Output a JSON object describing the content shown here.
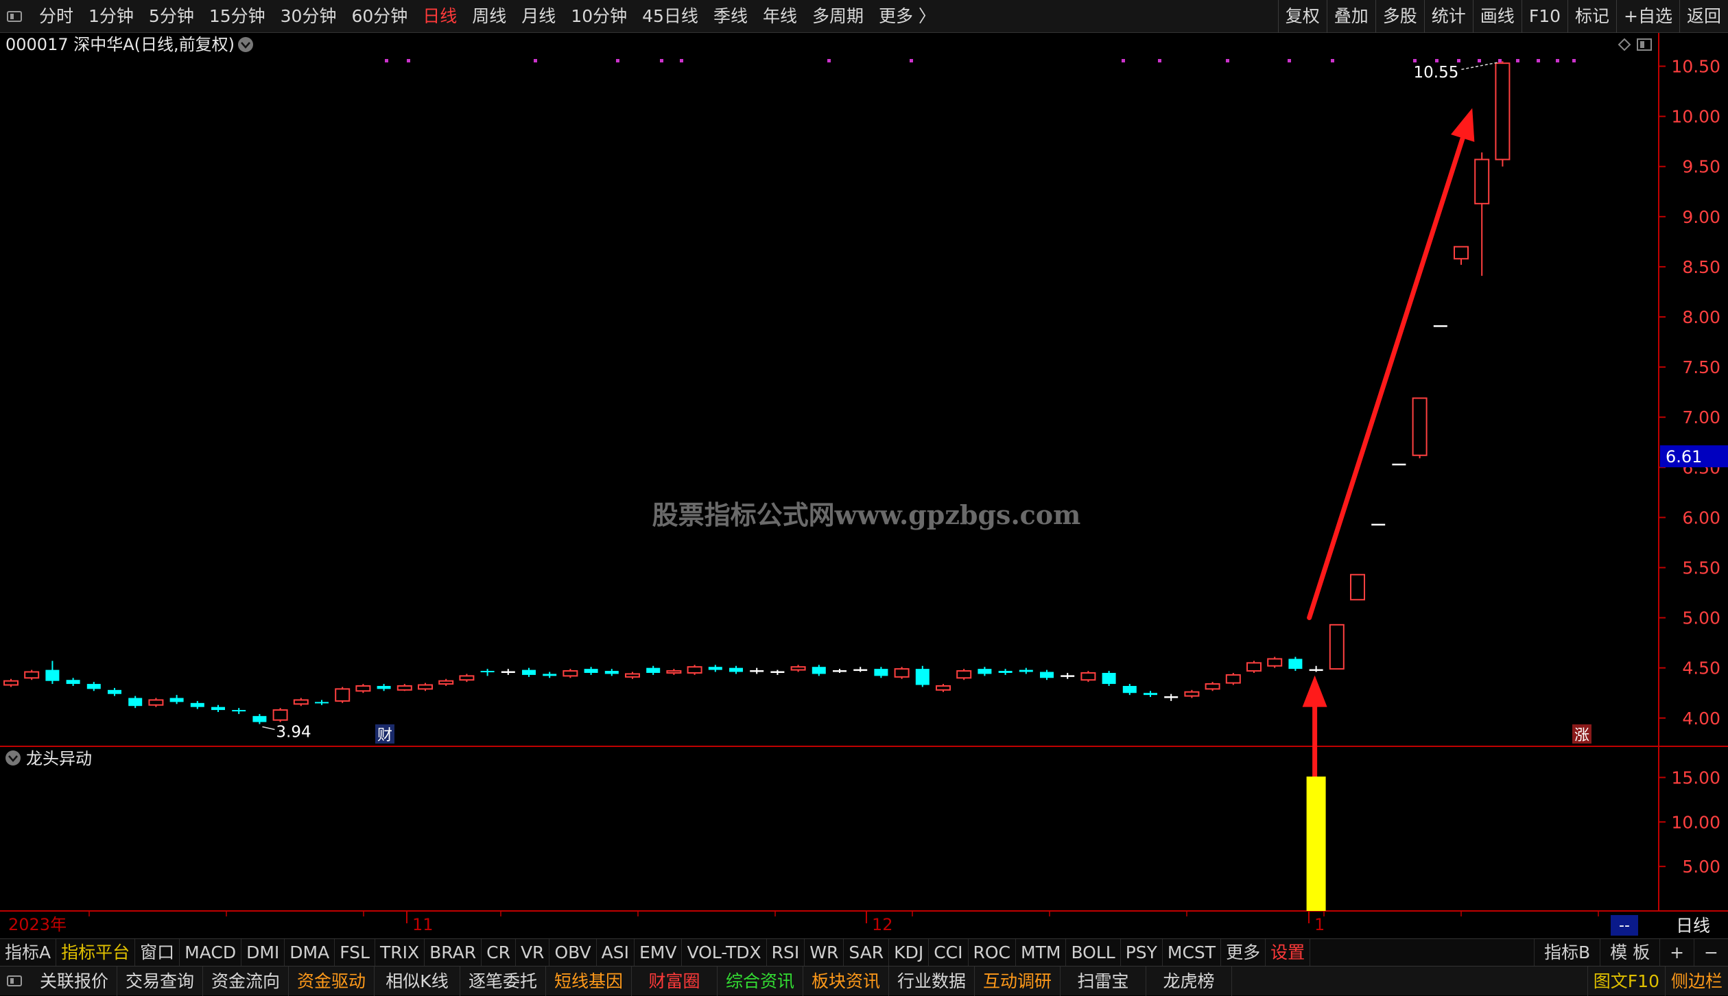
{
  "topbar": {
    "periods": [
      "分时",
      "1分钟",
      "5分钟",
      "15分钟",
      "30分钟",
      "60分钟",
      "日线",
      "周线",
      "月线",
      "10分钟",
      "45日线",
      "季线",
      "年线",
      "多周期",
      "更多 〉"
    ],
    "active_period": "日线",
    "right_buttons": [
      "复权",
      "叠加",
      "多股",
      "统计",
      "画线",
      "F10",
      "标记",
      "+自选",
      "返回"
    ]
  },
  "stock": {
    "title": "000017 深中华A(日线,前复权)"
  },
  "watermark": "股票指标公式网www.gpzbgs.com",
  "colors": {
    "up": "#ff4040",
    "down": "#00ffff",
    "axis": "#c00000",
    "vol": "#ffff00",
    "marker": "#cc33cc",
    "price_tag_bg": "#0000c0"
  },
  "chart_data": {
    "type": "candlestick",
    "ylim": [
      3.8,
      10.75
    ],
    "y_ticks": [
      "10.50",
      "10.00",
      "9.50",
      "9.00",
      "8.50",
      "8.00",
      "7.50",
      "7.00",
      "6.50",
      "6.00",
      "5.50",
      "5.00",
      "4.50",
      "4.00"
    ],
    "candles": [
      {
        "o": 4.33,
        "c": 4.37,
        "h": 4.39,
        "l": 4.31
      },
      {
        "o": 4.4,
        "c": 4.46,
        "h": 4.48,
        "l": 4.38
      },
      {
        "o": 4.48,
        "c": 4.37,
        "h": 4.57,
        "l": 4.34
      },
      {
        "o": 4.38,
        "c": 4.34,
        "h": 4.4,
        "l": 4.32
      },
      {
        "o": 4.34,
        "c": 4.29,
        "h": 4.36,
        "l": 4.27
      },
      {
        "o": 4.28,
        "c": 4.24,
        "h": 4.3,
        "l": 4.22
      },
      {
        "o": 4.2,
        "c": 4.12,
        "h": 4.22,
        "l": 4.1
      },
      {
        "o": 4.13,
        "c": 4.18,
        "h": 4.2,
        "l": 4.11
      },
      {
        "o": 4.2,
        "c": 4.16,
        "h": 4.23,
        "l": 4.14
      },
      {
        "o": 4.15,
        "c": 4.11,
        "h": 4.17,
        "l": 4.09
      },
      {
        "o": 4.11,
        "c": 4.08,
        "h": 4.13,
        "l": 4.06
      },
      {
        "o": 4.08,
        "c": 4.07,
        "h": 4.1,
        "l": 4.04
      },
      {
        "o": 4.02,
        "c": 3.96,
        "h": 4.04,
        "l": 3.94
      },
      {
        "o": 3.98,
        "c": 4.08,
        "h": 4.1,
        "l": 3.96
      },
      {
        "o": 4.14,
        "c": 4.18,
        "h": 4.2,
        "l": 4.12
      },
      {
        "o": 4.16,
        "c": 4.15,
        "h": 4.18,
        "l": 4.13
      },
      {
        "o": 4.17,
        "c": 4.29,
        "h": 4.31,
        "l": 4.15
      },
      {
        "o": 4.27,
        "c": 4.32,
        "h": 4.34,
        "l": 4.25
      },
      {
        "o": 4.32,
        "c": 4.29,
        "h": 4.34,
        "l": 4.27
      },
      {
        "o": 4.28,
        "c": 4.32,
        "h": 4.34,
        "l": 4.27
      },
      {
        "o": 4.29,
        "c": 4.33,
        "h": 4.35,
        "l": 4.27
      },
      {
        "o": 4.34,
        "c": 4.37,
        "h": 4.39,
        "l": 4.32
      },
      {
        "o": 4.38,
        "c": 4.42,
        "h": 4.44,
        "l": 4.36
      },
      {
        "o": 4.47,
        "c": 4.46,
        "h": 4.49,
        "l": 4.42
      },
      {
        "o": 4.46,
        "c": 4.46,
        "h": 4.49,
        "l": 4.43
      },
      {
        "o": 4.48,
        "c": 4.43,
        "h": 4.5,
        "l": 4.41
      },
      {
        "o": 4.44,
        "c": 4.42,
        "h": 4.46,
        "l": 4.4
      },
      {
        "o": 4.42,
        "c": 4.47,
        "h": 4.49,
        "l": 4.4
      },
      {
        "o": 4.49,
        "c": 4.45,
        "h": 4.51,
        "l": 4.43
      },
      {
        "o": 4.47,
        "c": 4.44,
        "h": 4.49,
        "l": 4.42
      },
      {
        "o": 4.41,
        "c": 4.44,
        "h": 4.46,
        "l": 4.39
      },
      {
        "o": 4.5,
        "c": 4.45,
        "h": 4.52,
        "l": 4.43
      },
      {
        "o": 4.45,
        "c": 4.47,
        "h": 4.49,
        "l": 4.43
      },
      {
        "o": 4.45,
        "c": 4.51,
        "h": 4.53,
        "l": 4.43
      },
      {
        "o": 4.51,
        "c": 4.48,
        "h": 4.53,
        "l": 4.46
      },
      {
        "o": 4.5,
        "c": 4.46,
        "h": 4.52,
        "l": 4.44
      },
      {
        "o": 4.47,
        "c": 4.47,
        "h": 4.5,
        "l": 4.44
      },
      {
        "o": 4.46,
        "c": 4.46,
        "h": 4.48,
        "l": 4.43
      },
      {
        "o": 4.48,
        "c": 4.51,
        "h": 4.53,
        "l": 4.46
      },
      {
        "o": 4.51,
        "c": 4.44,
        "h": 4.53,
        "l": 4.42
      },
      {
        "o": 4.47,
        "c": 4.47,
        "h": 4.49,
        "l": 4.45
      },
      {
        "o": 4.48,
        "c": 4.48,
        "h": 4.51,
        "l": 4.46
      },
      {
        "o": 4.49,
        "c": 4.42,
        "h": 4.51,
        "l": 4.4
      },
      {
        "o": 4.41,
        "c": 4.49,
        "h": 4.51,
        "l": 4.39
      },
      {
        "o": 4.49,
        "c": 4.33,
        "h": 4.52,
        "l": 4.31
      },
      {
        "o": 4.28,
        "c": 4.32,
        "h": 4.34,
        "l": 4.26
      },
      {
        "o": 4.4,
        "c": 4.47,
        "h": 4.49,
        "l": 4.38
      },
      {
        "o": 4.49,
        "c": 4.44,
        "h": 4.51,
        "l": 4.42
      },
      {
        "o": 4.47,
        "c": 4.45,
        "h": 4.49,
        "l": 4.43
      },
      {
        "o": 4.48,
        "c": 4.46,
        "h": 4.5,
        "l": 4.44
      },
      {
        "o": 4.46,
        "c": 4.4,
        "h": 4.48,
        "l": 4.38
      },
      {
        "o": 4.42,
        "c": 4.42,
        "h": 4.45,
        "l": 4.39
      },
      {
        "o": 4.38,
        "c": 4.45,
        "h": 4.47,
        "l": 4.36
      },
      {
        "o": 4.45,
        "c": 4.34,
        "h": 4.47,
        "l": 4.32
      },
      {
        "o": 4.32,
        "c": 4.25,
        "h": 4.34,
        "l": 4.23
      },
      {
        "o": 4.25,
        "c": 4.23,
        "h": 4.27,
        "l": 4.21
      },
      {
        "o": 4.21,
        "c": 4.21,
        "h": 4.24,
        "l": 4.17
      },
      {
        "o": 4.22,
        "c": 4.26,
        "h": 4.28,
        "l": 4.2
      },
      {
        "o": 4.29,
        "c": 4.34,
        "h": 4.36,
        "l": 4.27
      },
      {
        "o": 4.35,
        "c": 4.43,
        "h": 4.45,
        "l": 4.33
      },
      {
        "o": 4.47,
        "c": 4.55,
        "h": 4.57,
        "l": 4.45
      },
      {
        "o": 4.52,
        "c": 4.59,
        "h": 4.61,
        "l": 4.5
      },
      {
        "o": 4.59,
        "c": 4.49,
        "h": 4.61,
        "l": 4.47
      },
      {
        "o": 4.48,
        "c": 4.48,
        "h": 4.52,
        "l": 4.46
      },
      {
        "o": 4.49,
        "c": 4.93,
        "h": 4.93,
        "l": 4.49
      },
      {
        "o": 5.18,
        "c": 5.43,
        "h": 5.43,
        "l": 5.18
      },
      {
        "o": 5.93,
        "c": 5.93,
        "h": 5.93,
        "l": 5.93
      },
      {
        "o": 6.53,
        "c": 6.53,
        "h": 6.53,
        "l": 6.53
      },
      {
        "o": 6.62,
        "c": 7.19,
        "h": 7.19,
        "l": 6.59
      },
      {
        "o": 7.91,
        "c": 7.91,
        "h": 7.91,
        "l": 7.91
      },
      {
        "o": 8.58,
        "c": 8.7,
        "h": 8.7,
        "l": 8.52
      },
      {
        "o": 9.13,
        "c": 9.57,
        "h": 9.64,
        "l": 8.41
      },
      {
        "o": 9.57,
        "c": 10.53,
        "h": 10.55,
        "l": 9.5
      }
    ],
    "high_label": "10.55",
    "low_label": "3.94",
    "current_price": "6.61",
    "x_labels": [
      "2023年",
      "11",
      "12",
      "1"
    ],
    "markers": {
      "cai": "财",
      "zhang": "涨"
    },
    "volume": {
      "indicator_name": "龙头异动",
      "ylim": [
        0,
        18.5
      ],
      "y_ticks": [
        "15.00",
        "10.00",
        "5.00"
      ],
      "bar_index": 63,
      "bar_value": 15.1
    }
  },
  "rightbar": {
    "period_tag": "日线",
    "dashes": "--"
  },
  "indicator_tabs": [
    "指标A",
    "指标平台",
    "窗口",
    "MACD",
    "DMI",
    "DMA",
    "FSL",
    "TRIX",
    "BRAR",
    "CR",
    "VR",
    "OBV",
    "ASI",
    "EMV",
    "VOL-TDX",
    "RSI",
    "WR",
    "SAR",
    "KDJ",
    "CCI",
    "ROC",
    "MTM",
    "BOLL",
    "PSY",
    "MCST",
    "更多",
    "设置"
  ],
  "indicator_right": [
    "指标B",
    "模 板",
    "+",
    "−"
  ],
  "bottom_buttons": [
    "关联报价",
    "交易查询",
    "资金流向",
    "资金驱动",
    "相似K线",
    "逐笔委托",
    "短线基因",
    "财富圈",
    "综合资讯",
    "板块资讯",
    "行业数据",
    "互动调研",
    "扫雷宝",
    "龙虎榜"
  ],
  "bottom_right": [
    "图文F10",
    "侧边栏"
  ]
}
